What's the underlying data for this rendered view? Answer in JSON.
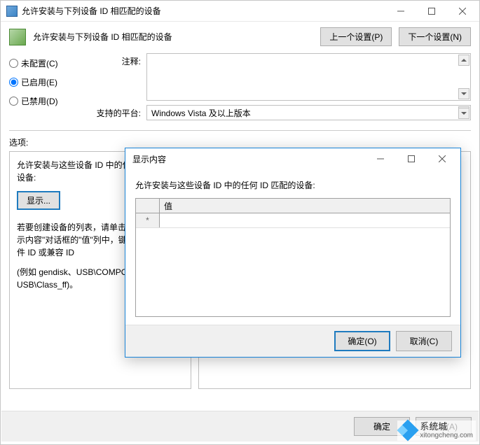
{
  "window": {
    "title": "允许安装与下列设备 ID 相匹配的设备",
    "header_title": "允许安装与下列设备 ID 相匹配的设备",
    "prev_setting": "上一个设置(P)",
    "next_setting": "下一个设置(N)"
  },
  "radios": {
    "not_configured": "未配置(C)",
    "enabled": "已启用(E)",
    "disabled": "已禁用(D)",
    "selected": "enabled"
  },
  "labels": {
    "comment": "注释:",
    "platform": "支持的平台:",
    "options": "选项:"
  },
  "platform_value": "Windows Vista 及以上版本",
  "option_panel": {
    "line1": "允许安装与这些设备 ID 中的任何 ID 匹配的设备:",
    "show_button": "显示...",
    "line2": "若要创建设备的列表，请单击\"显示\"。在\"显示内容\"对话框的\"值\"列中，键入即插即用硬件 ID 或兼容 ID",
    "line3": "(例如 gendisk、USB\\COMPOSITE、USB\\Class_ff)。"
  },
  "modal": {
    "title": "显示内容",
    "instruction": "允许安装与这些设备 ID 中的任何 ID 匹配的设备:",
    "column_header": "值",
    "row_marker": "*",
    "ok": "确定(O)",
    "cancel": "取消(C)"
  },
  "footer": {
    "ok": "确定",
    "apply": "应用(A)"
  },
  "watermark": {
    "brand": "系统城",
    "url": "xitongcheng.com"
  }
}
